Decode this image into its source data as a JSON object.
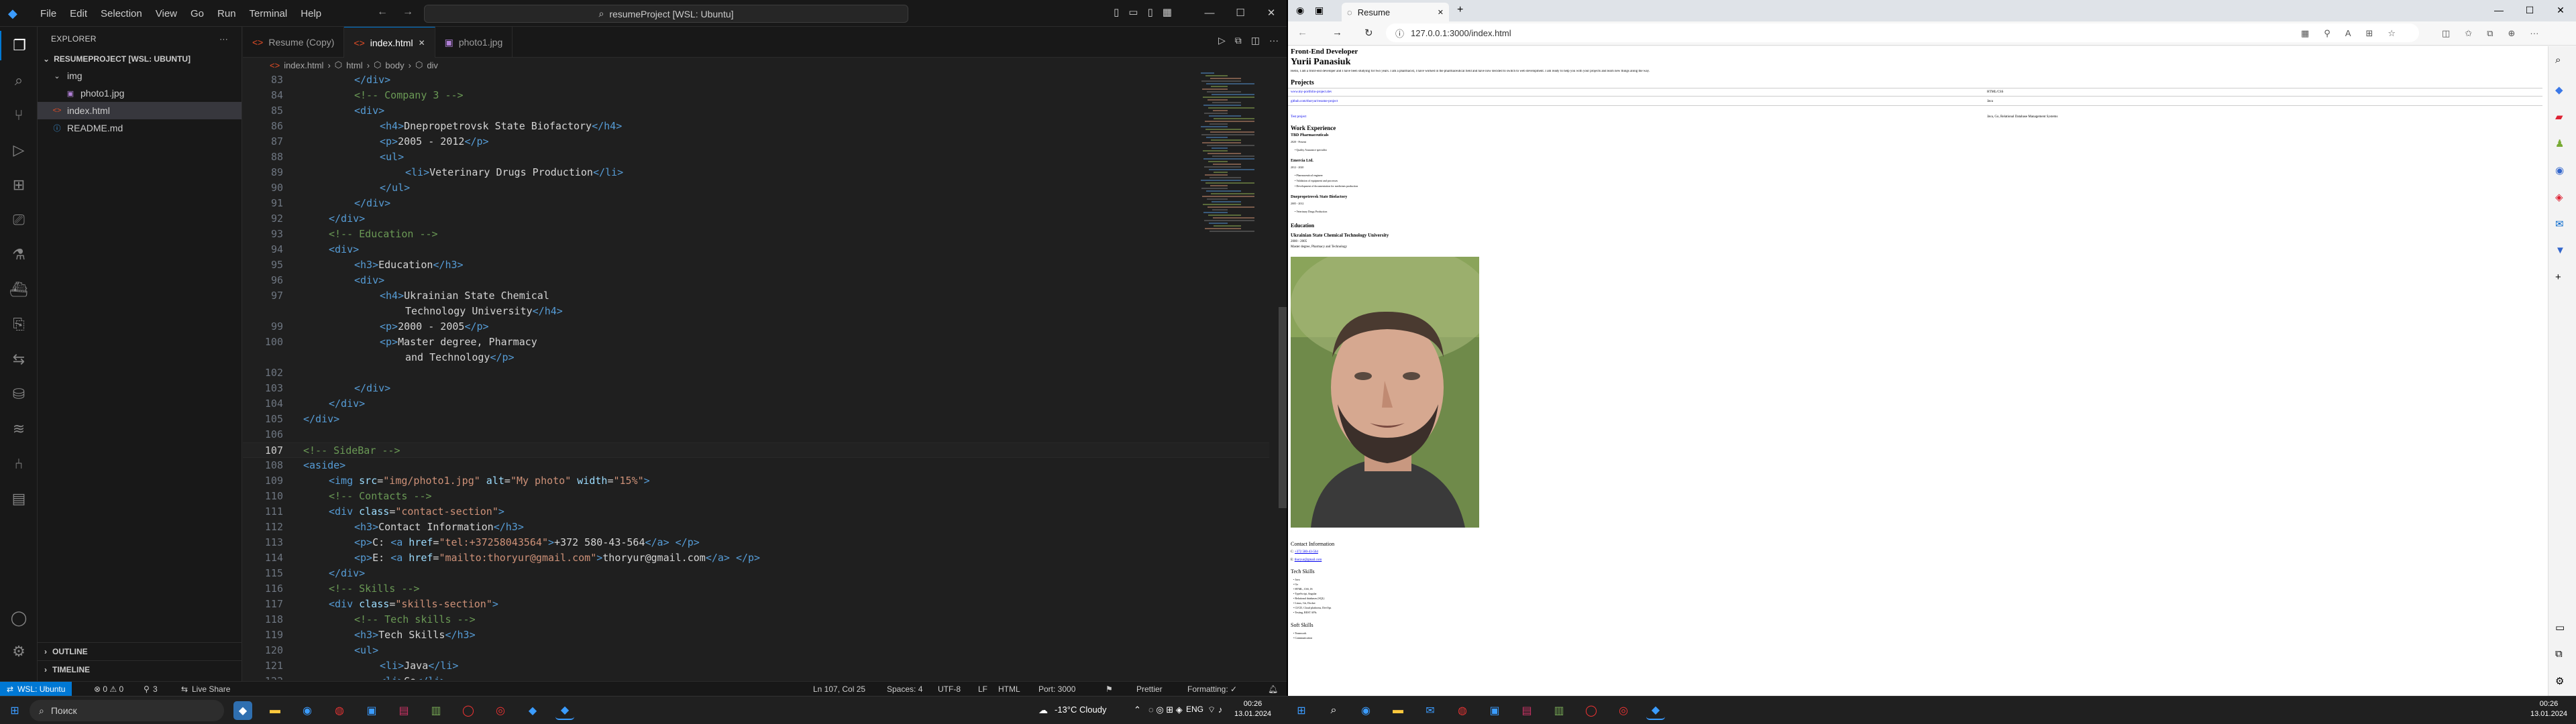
{
  "vscode": {
    "menu": [
      "File",
      "Edit",
      "Selection",
      "View",
      "Go",
      "Run",
      "Terminal",
      "Help"
    ],
    "search_text": "resumeProject [WSL: Ubuntu]",
    "explorer": {
      "title": "EXPLORER",
      "project": "RESUMEPROJECT [WSL: UBUNTU]",
      "items": [
        {
          "label": "img",
          "type": "folder"
        },
        {
          "label": "photo1.jpg",
          "type": "image"
        },
        {
          "label": "index.html",
          "type": "html"
        },
        {
          "label": "README.md",
          "type": "md"
        }
      ],
      "outline": "OUTLINE",
      "timeline": "TIMELINE"
    },
    "tabs": [
      {
        "label": "Resume (Copy)"
      },
      {
        "label": "index.html"
      },
      {
        "label": "photo1.jpg"
      }
    ],
    "breadcrumbs": [
      "index.html",
      "html",
      "body",
      "div"
    ],
    "code_lines": [
      {
        "n": "83",
        "i": 2,
        "p": [
          [
            "t",
            "</div>"
          ]
        ]
      },
      {
        "n": "84",
        "i": 2,
        "p": [
          [
            "c",
            "<!-- Company 3 -->"
          ]
        ]
      },
      {
        "n": "85",
        "i": 2,
        "p": [
          [
            "t",
            "<div>"
          ]
        ]
      },
      {
        "n": "86",
        "i": 3,
        "p": [
          [
            "t",
            "<h4>"
          ],
          [
            "tx",
            "Dnepropetrovsk State Biofactory"
          ],
          [
            "t",
            "</h4>"
          ]
        ]
      },
      {
        "n": "87",
        "i": 3,
        "p": [
          [
            "t",
            "<p>"
          ],
          [
            "tx",
            "2005 - 2012"
          ],
          [
            "t",
            "</p>"
          ]
        ]
      },
      {
        "n": "88",
        "i": 3,
        "p": [
          [
            "t",
            "<ul>"
          ]
        ]
      },
      {
        "n": "89",
        "i": 4,
        "p": [
          [
            "t",
            "<li>"
          ],
          [
            "tx",
            "Veterinary Drugs Production"
          ],
          [
            "t",
            "</li>"
          ]
        ]
      },
      {
        "n": "90",
        "i": 3,
        "p": [
          [
            "t",
            "</ul>"
          ]
        ]
      },
      {
        "n": "91",
        "i": 2,
        "p": [
          [
            "t",
            "</div>"
          ]
        ]
      },
      {
        "n": "92",
        "i": 1,
        "p": [
          [
            "t",
            "</div>"
          ]
        ]
      },
      {
        "n": "93",
        "i": 1,
        "p": [
          [
            "c",
            "<!-- Education -->"
          ]
        ]
      },
      {
        "n": "94",
        "i": 1,
        "p": [
          [
            "t",
            "<div>"
          ]
        ]
      },
      {
        "n": "95",
        "i": 2,
        "p": [
          [
            "t",
            "<h3>"
          ],
          [
            "tx",
            "Education"
          ],
          [
            "t",
            "</h3>"
          ]
        ]
      },
      {
        "n": "96",
        "i": 2,
        "p": [
          [
            "t",
            "<div>"
          ]
        ]
      },
      {
        "n": "97",
        "i": 3,
        "p": [
          [
            "t",
            "<h4>"
          ],
          [
            "tx",
            "Ukrainian State Chemical"
          ]
        ]
      },
      {
        "n": "",
        "i": 4,
        "p": [
          [
            "tx",
            "Technology University"
          ],
          [
            "t",
            "</h4>"
          ]
        ]
      },
      {
        "n": "99",
        "i": 3,
        "p": [
          [
            "t",
            "<p>"
          ],
          [
            "tx",
            "2000 - 2005"
          ],
          [
            "t",
            "</p>"
          ]
        ]
      },
      {
        "n": "100",
        "i": 3,
        "p": [
          [
            "t",
            "<p>"
          ],
          [
            "tx",
            "Master degree, Pharmacy"
          ]
        ]
      },
      {
        "n": "",
        "i": 4,
        "p": [
          [
            "tx",
            "and Technology"
          ],
          [
            "t",
            "</p>"
          ]
        ]
      },
      {
        "n": "102",
        "i": 0,
        "p": []
      },
      {
        "n": "103",
        "i": 2,
        "p": [
          [
            "t",
            "</div>"
          ]
        ]
      },
      {
        "n": "104",
        "i": 1,
        "p": [
          [
            "t",
            "</div>"
          ]
        ]
      },
      {
        "n": "105",
        "i": 0,
        "p": [
          [
            "t",
            "</div>"
          ]
        ]
      },
      {
        "n": "106",
        "i": 0,
        "p": []
      },
      {
        "n": "107",
        "i": 0,
        "p": [
          [
            "c",
            "<!-- SideBar -->"
          ]
        ]
      },
      {
        "n": "108",
        "i": 0,
        "p": [
          [
            "t",
            "<aside>"
          ]
        ]
      },
      {
        "n": "109",
        "i": 1,
        "p": [
          [
            "t",
            "<img "
          ],
          [
            "a",
            "src"
          ],
          [
            "tx",
            "="
          ],
          [
            "s",
            "\"img/photo1.jpg\""
          ],
          [
            "a",
            " alt"
          ],
          [
            "tx",
            "="
          ],
          [
            "s",
            "\"My photo\""
          ],
          [
            "a",
            " width"
          ],
          [
            "tx",
            "="
          ],
          [
            "s",
            "\"15%\""
          ],
          [
            "t",
            ">"
          ]
        ]
      },
      {
        "n": "110",
        "i": 1,
        "p": [
          [
            "c",
            "<!-- Contacts -->"
          ]
        ]
      },
      {
        "n": "111",
        "i": 1,
        "p": [
          [
            "t",
            "<div "
          ],
          [
            "a",
            "class"
          ],
          [
            "tx",
            "="
          ],
          [
            "s",
            "\"contact-section\""
          ],
          [
            "t",
            ">"
          ]
        ]
      },
      {
        "n": "112",
        "i": 2,
        "p": [
          [
            "t",
            "<h3>"
          ],
          [
            "tx",
            "Contact Information"
          ],
          [
            "t",
            "</h3>"
          ]
        ]
      },
      {
        "n": "113",
        "i": 2,
        "p": [
          [
            "t",
            "<p>"
          ],
          [
            "tx",
            "C: "
          ],
          [
            "t",
            "<a "
          ],
          [
            "a",
            "href"
          ],
          [
            "tx",
            "="
          ],
          [
            "s",
            "\"tel:+37258043564\""
          ],
          [
            "t",
            ">"
          ],
          [
            "tx",
            "+372 580-43-564"
          ],
          [
            "t",
            "</a>"
          ],
          [
            "tx",
            " "
          ],
          [
            "t",
            "</p>"
          ]
        ]
      },
      {
        "n": "114",
        "i": 2,
        "p": [
          [
            "t",
            "<p>"
          ],
          [
            "tx",
            "E: "
          ],
          [
            "t",
            "<a "
          ],
          [
            "a",
            "href"
          ],
          [
            "tx",
            "="
          ],
          [
            "s",
            "\"mailto:thoryur@gmail.com\""
          ],
          [
            "t",
            ">"
          ],
          [
            "tx",
            "thoryur@gmail.com"
          ],
          [
            "t",
            "</a>"
          ],
          [
            "tx",
            " "
          ],
          [
            "t",
            "</p>"
          ]
        ]
      },
      {
        "n": "115",
        "i": 1,
        "p": [
          [
            "t",
            "</div>"
          ]
        ]
      },
      {
        "n": "116",
        "i": 1,
        "p": [
          [
            "c",
            "<!-- Skills -->"
          ]
        ]
      },
      {
        "n": "117",
        "i": 1,
        "p": [
          [
            "t",
            "<div "
          ],
          [
            "a",
            "class"
          ],
          [
            "tx",
            "="
          ],
          [
            "s",
            "\"skills-section\""
          ],
          [
            "t",
            ">"
          ]
        ]
      },
      {
        "n": "118",
        "i": 2,
        "p": [
          [
            "c",
            "<!-- Tech skills -->"
          ]
        ]
      },
      {
        "n": "119",
        "i": 2,
        "p": [
          [
            "t",
            "<h3>"
          ],
          [
            "tx",
            "Tech Skills"
          ],
          [
            "t",
            "</h3>"
          ]
        ]
      },
      {
        "n": "120",
        "i": 2,
        "p": [
          [
            "t",
            "<ul>"
          ]
        ]
      },
      {
        "n": "121",
        "i": 3,
        "p": [
          [
            "t",
            "<li>"
          ],
          [
            "tx",
            "Java"
          ],
          [
            "t",
            "</li>"
          ]
        ]
      },
      {
        "n": "122",
        "i": 3,
        "p": [
          [
            "t",
            "<li>"
          ],
          [
            "tx",
            "Go"
          ],
          [
            "t",
            "</li>"
          ]
        ]
      }
    ],
    "status": {
      "remote": "WSL: Ubuntu",
      "problems": "⊗ 0 ⚠ 0",
      "ports_count": "3",
      "live_share": "Live Share",
      "position": "Ln 107, Col 25",
      "spaces": "Spaces: 4",
      "encoding": "UTF-8",
      "eol": "LF",
      "language": "HTML",
      "port": "Port: 3000",
      "prettier": "Prettier",
      "formatting": "Formatting: ✓"
    }
  },
  "browser": {
    "tab_title": "Resume",
    "url": "127.0.0.1:3000/index.html",
    "page": {
      "role": "Front-End Developer",
      "name": "Yurii Panasiuk",
      "summary": "Hello, I am a front-end developer and I have been studying for two years. I am a pharmacist, I have worked in the pharmaceutical field and have now decided to switch to web development. I am ready to help you with your projects and learn new things along the way.",
      "projects_title": "Projects",
      "projects": [
        {
          "link": "www.my-portfolio-project.dev",
          "tech": "HTML/CSS"
        },
        {
          "link": "github.com/thoryur/resume-project",
          "tech": "Java"
        },
        {
          "link": "Test project",
          "tech": "Java, Go, Relational Database Management Systems"
        }
      ],
      "experience_title": "Work Experience",
      "jobs": [
        {
          "company": "TBD Pharmaceuticals",
          "period": "2020 - Present",
          "items": [
            "Quality Assurance specialist"
          ]
        },
        {
          "company": "Emercia Ltd.",
          "period": "2012 - 2020",
          "items": [
            "Pharmaceutical engineer",
            "Validation of equipment and processes",
            "Development of documentation for medicines production"
          ]
        },
        {
          "company": "Dnepropetrovsk State Biofactory",
          "period": "2005 - 2012",
          "items": [
            "Veterinary Drugs Production"
          ]
        }
      ],
      "education_title": "Education",
      "school": "Ukrainian State Chemical Technology University",
      "school_period": "2000 - 2005",
      "degree": "Master degree, Pharmacy and Technology",
      "contact_title": "Contact Information",
      "phone_prefix": "C: ",
      "phone": "+372 580-43-564",
      "email_prefix": "E: ",
      "email": "thoryur@gmail.com",
      "tech_title": "Tech Skills",
      "tech": [
        "Java",
        "Go",
        "HTML, CSS, JS",
        "TypeScript, Angular",
        "Relational databases (SQL)",
        "Linux, Git, Docker",
        "CI/CD, Cloud platforms, DevOps",
        "Testing, REST APIs"
      ],
      "soft_title": "Soft Skills",
      "soft": [
        "Teamwork",
        "Communication"
      ]
    }
  },
  "taskbar": {
    "search_placeholder": "Поиск",
    "weather": "-13°C Cloudy",
    "lang": "ENG",
    "time_left": "00:26",
    "date_left": "13.01.2024",
    "time_right": "00:26",
    "date_right": "13.01.2024"
  },
  "colors": {
    "vscode_bg": "#1f1f1f",
    "accent": "#0078d4",
    "tag": "#569cd6",
    "attr": "#9cdcfe",
    "string": "#ce9178",
    "comment": "#6a9955"
  }
}
